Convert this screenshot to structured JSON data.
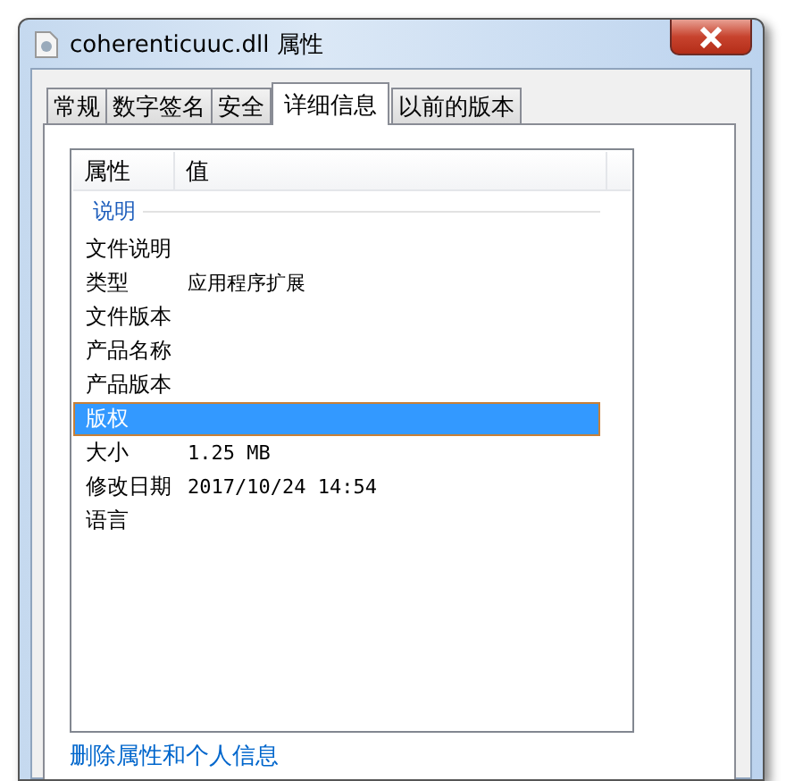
{
  "window": {
    "title": "coherenticuuc.dll 属性"
  },
  "tabs": [
    {
      "label": "常规",
      "selected": false
    },
    {
      "label": "数字签名",
      "selected": false
    },
    {
      "label": "安全",
      "selected": false
    },
    {
      "label": "详细信息",
      "selected": true
    },
    {
      "label": "以前的版本",
      "selected": false
    }
  ],
  "table": {
    "columns": [
      "属性",
      "值"
    ],
    "group": "说明",
    "rows": [
      {
        "name": "文件说明",
        "value": "",
        "selected": false
      },
      {
        "name": "类型",
        "value": "应用程序扩展",
        "selected": false
      },
      {
        "name": "文件版本",
        "value": "",
        "selected": false
      },
      {
        "name": "产品名称",
        "value": "",
        "selected": false
      },
      {
        "name": "产品版本",
        "value": "",
        "selected": false
      },
      {
        "name": "版权",
        "value": "",
        "selected": true
      },
      {
        "name": "大小",
        "value": "1.25 MB",
        "selected": false
      },
      {
        "name": "修改日期",
        "value": "2017/10/24 14:54",
        "selected": false
      },
      {
        "name": "语言",
        "value": "",
        "selected": false
      }
    ]
  },
  "link": "删除属性和个人信息"
}
